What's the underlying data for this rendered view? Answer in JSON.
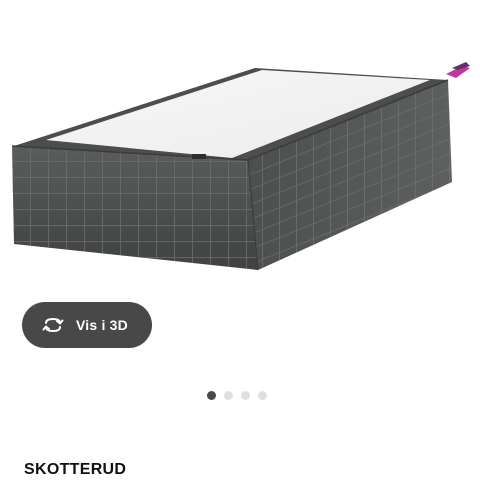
{
  "product": {
    "name": "SKOTTERUD",
    "image_alt": "Box spring bed base, dark grey"
  },
  "view_3d": {
    "label": "Vis i 3D",
    "icon": "rotate-3d-icon"
  },
  "carousel": {
    "total_images": 4,
    "active_index": 0
  },
  "colors": {
    "button_bg": "#484848",
    "dot_active": "#484848",
    "dot_inactive": "#dfdfdf",
    "fabric": "#505351",
    "mattress_top": "#f3f3f3"
  }
}
